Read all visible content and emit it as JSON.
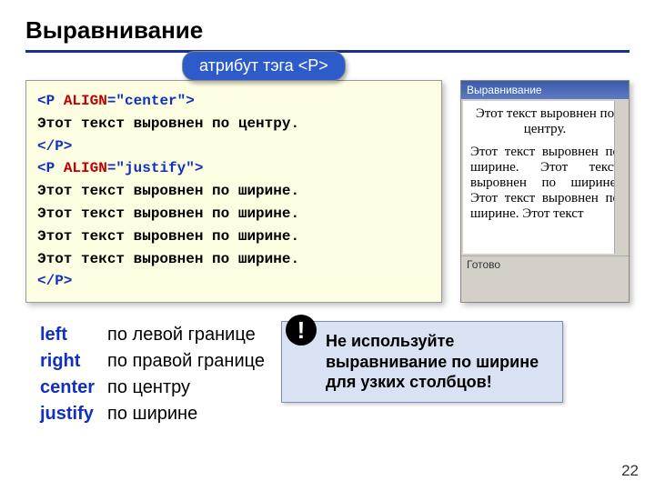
{
  "title": "Выравнивание",
  "badge": "атрибут тэга <P>",
  "code": {
    "line1_tag_open": "<P ",
    "line1_attr": "ALIGN",
    "line1_eq": "=\"center\">",
    "line2": "Этот текст выровнен по центру.",
    "line3": "</P>",
    "line4_tag_open": "<P ",
    "line4_attr": "ALIGN",
    "line4_eq": "=\"justify\">",
    "line5": "Этот текст выровнен по ширине.",
    "line6": "Этот текст выровнен по ширине.",
    "line7": "Этот текст выровнен по ширине.",
    "line8": "Этот текст выровнен по ширине.",
    "line9": "</P>"
  },
  "preview": {
    "title": "Выравнивание",
    "center_text": "Этот текст выровнен по центру.",
    "justify_text": "Этот текст выровнен по ширине. Этот текст выровнен по ширине. Этот текст выровнен по ширине. Этот текст",
    "status": "Готово"
  },
  "defs": [
    {
      "key": "left",
      "val": "по левой границе"
    },
    {
      "key": "right",
      "val": "по правой границе"
    },
    {
      "key": "center",
      "val": "по центру"
    },
    {
      "key": "justify",
      "val": "по ширине"
    }
  ],
  "warn": {
    "icon": "!",
    "text": "Не используйте выравнивание по ширине для узких столбцов!"
  },
  "page_num": "22"
}
